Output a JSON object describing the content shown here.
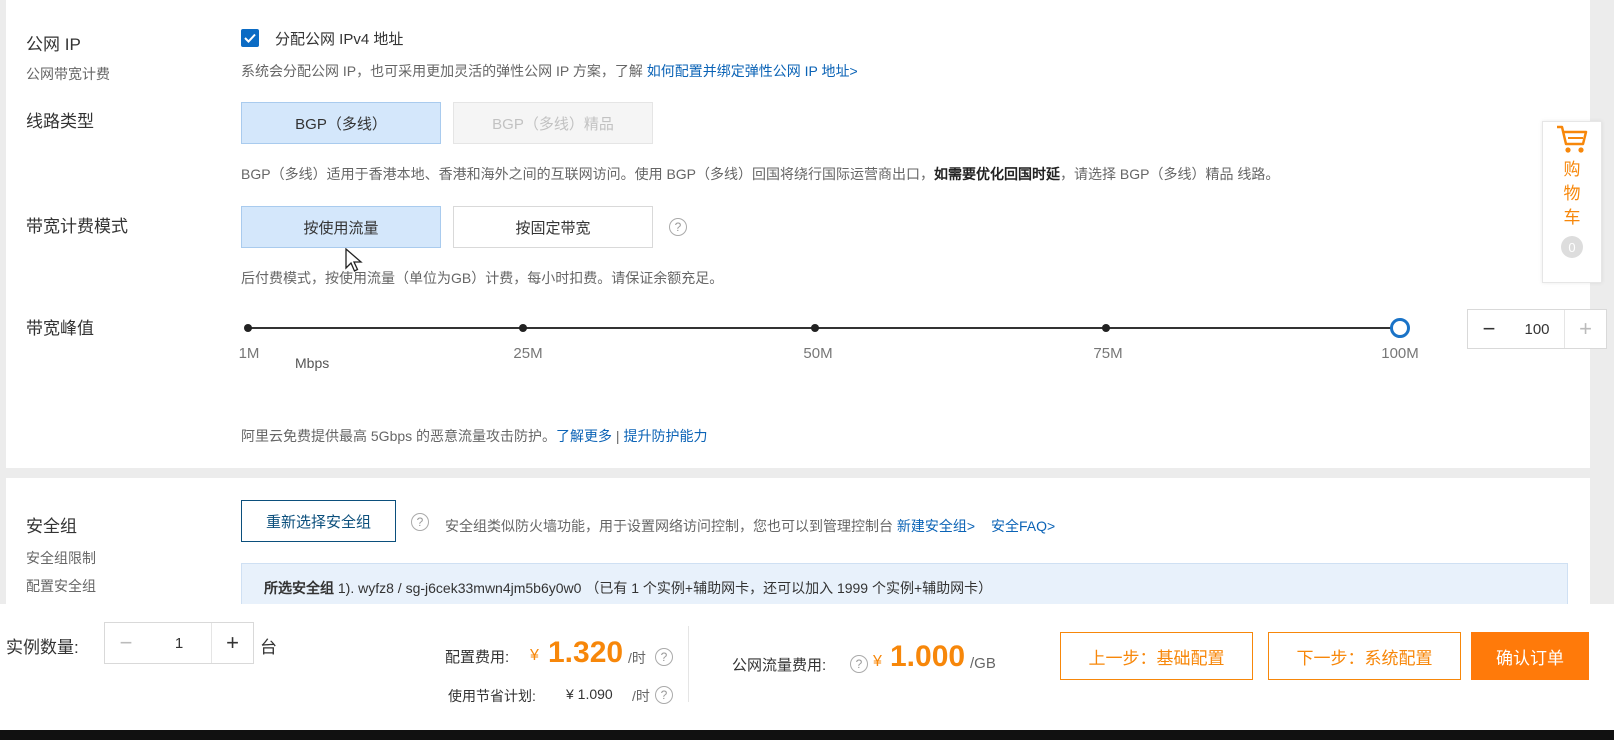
{
  "public_ip": {
    "label": "公网 IP",
    "sublabel": "公网带宽计费",
    "checkbox_label": "分配公网 IPv4 地址",
    "hint_text": "系统会分配公网 IP，也可采用更加灵活的弹性公网 IP 方案，了解 ",
    "hint_link": "如何配置并绑定弹性公网 IP 地址>"
  },
  "line_type": {
    "label": "线路类型",
    "options": [
      "BGP（多线）",
      "BGP（多线）精品"
    ],
    "hint_text": "BGP（多线）适用于香港本地、香港和海外之间的互联网访问。使用 BGP（多线）回国将绕行国际运营商出口，",
    "hint_bold": "如需要优化回国时延",
    "hint_tail": "，请选择 BGP（多线）精品 线路。"
  },
  "billing_mode": {
    "label": "带宽计费模式",
    "options": [
      "按使用流量",
      "按固定带宽"
    ],
    "hint": "后付费模式，按使用流量（单位为GB）计费，每小时扣费。请保证余额充足。"
  },
  "bandwidth_peak": {
    "label": "带宽峰值",
    "ticks": [
      "1M",
      "25M",
      "50M",
      "75M",
      "100M"
    ],
    "unit": "Mbps",
    "value": "100",
    "minus": "−",
    "plus": "+",
    "protect_text": "阿里云免费提供最高 5Gbps 的恶意流量攻击防护。",
    "link_more": "了解更多",
    "separator": "|",
    "link_upgrade": "提升防护能力"
  },
  "security_group": {
    "label": "安全组",
    "sublabel1": "安全组限制",
    "sublabel2": "配置安全组",
    "reselect_button": "重新选择安全组",
    "hint_text": "安全组类似防火墙功能，用于设置网络访问控制，您也可以到管理控制台 ",
    "link_new": "新建安全组>",
    "link_faq": "安全FAQ>",
    "selected_label": "所选安全组",
    "selected_value": " 1). wyfz8 / sg-j6cek33mwn4jm5b6y0w0 （已有 1 个实例+辅助网卡，还可以加入 1999 个实例+辅助网卡）"
  },
  "cart": {
    "label_chars": [
      "购",
      "物",
      "车"
    ],
    "count": "0"
  },
  "footer": {
    "instance_label": "实例数量:",
    "instance_value": "1",
    "instance_unit": "台",
    "minus": "−",
    "plus": "+",
    "config_fee_label": "配置费用:",
    "yen": "¥",
    "config_fee_value": "1.320",
    "per_hour": "/时",
    "saving_label": "使用节省计划:",
    "saving_value": "¥ 1.090",
    "traffic_fee_label": "公网流量费用:",
    "traffic_fee_value": "1.000",
    "per_gb": "/GB",
    "prev_button": "上一步：基础配置",
    "next_button": "下一步：系统配置",
    "confirm_button": "确认订单"
  },
  "colors": {
    "accent_blue": "#0b63b6",
    "accent_orange": "#f7870a",
    "selected_bg": "#d4e7fb"
  }
}
